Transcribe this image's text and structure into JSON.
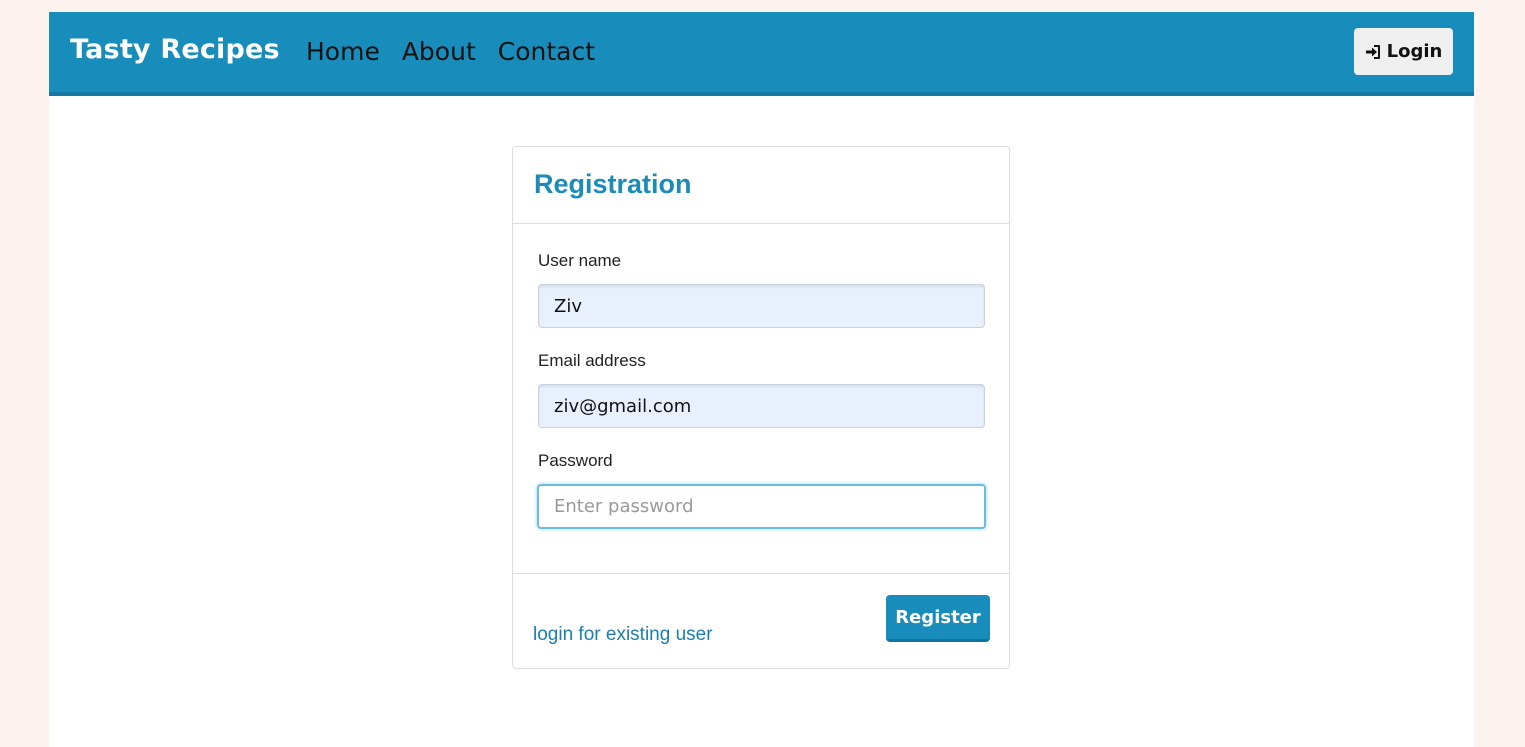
{
  "navbar": {
    "brand": "Tasty Recipes",
    "links": [
      {
        "label": "Home"
      },
      {
        "label": "About"
      },
      {
        "label": "Contact"
      }
    ],
    "login_label": "Login",
    "login_icon": "sign-in-icon",
    "bg_color": "#188dbb"
  },
  "registration": {
    "title": "Registration",
    "fields": {
      "username": {
        "label": "User name",
        "value": "Ziv",
        "placeholder": ""
      },
      "email": {
        "label": "Email address",
        "value": "ziv@gmail.com",
        "placeholder": ""
      },
      "password": {
        "label": "Password",
        "value": "",
        "placeholder": "Enter password"
      }
    },
    "existing_user_link": "login for existing user",
    "register_label": "Register"
  }
}
